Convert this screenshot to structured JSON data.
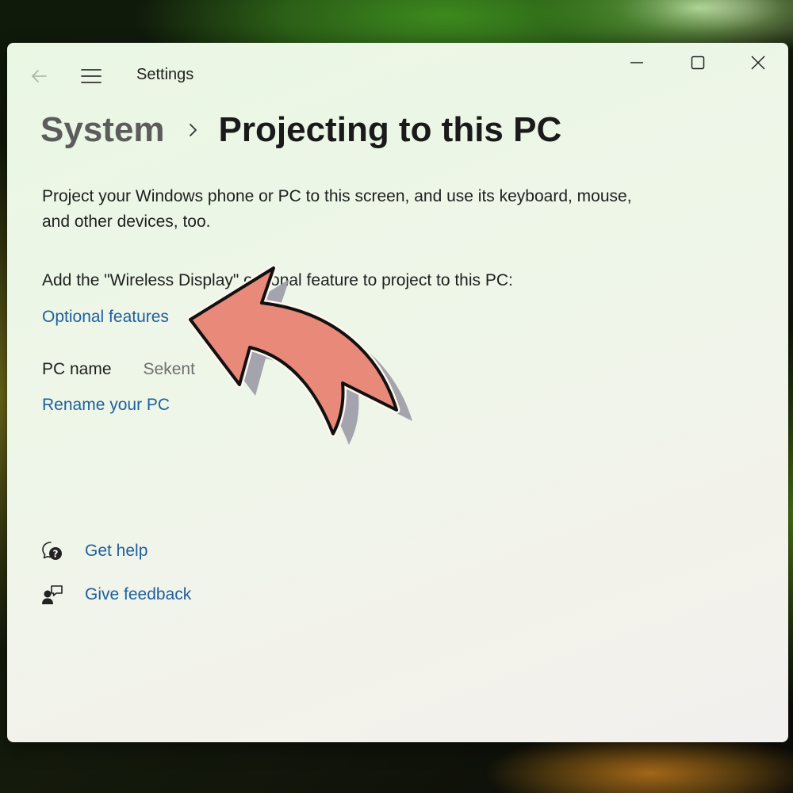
{
  "window": {
    "app_title": "Settings"
  },
  "breadcrumb": {
    "parent": "System",
    "current": "Projecting to this PC"
  },
  "content": {
    "description": "Project your Windows phone or PC to this screen, and use its keyboard, mouse, and other devices, too.",
    "feature_hint": "Add the \"Wireless Display\" optional feature to project to this PC:",
    "optional_features_link": "Optional features",
    "pc_name_label": "PC name",
    "pc_name_value": "Sekent",
    "rename_link": "Rename your PC"
  },
  "help": {
    "get_help": "Get help",
    "give_feedback": "Give feedback"
  },
  "icons": {
    "back": "back-arrow-icon",
    "menu": "hamburger-menu-icon",
    "minimize": "minimize-icon",
    "maximize": "maximize-icon",
    "close": "close-icon",
    "breadcrumb_separator": "chevron-right-icon",
    "get_help": "help-chat-icon",
    "give_feedback": "feedback-person-icon",
    "annotation": "curved-pointer-arrow-icon"
  },
  "colors": {
    "link": "#1e5f9e",
    "annotation_arrow": "#e8897a"
  }
}
